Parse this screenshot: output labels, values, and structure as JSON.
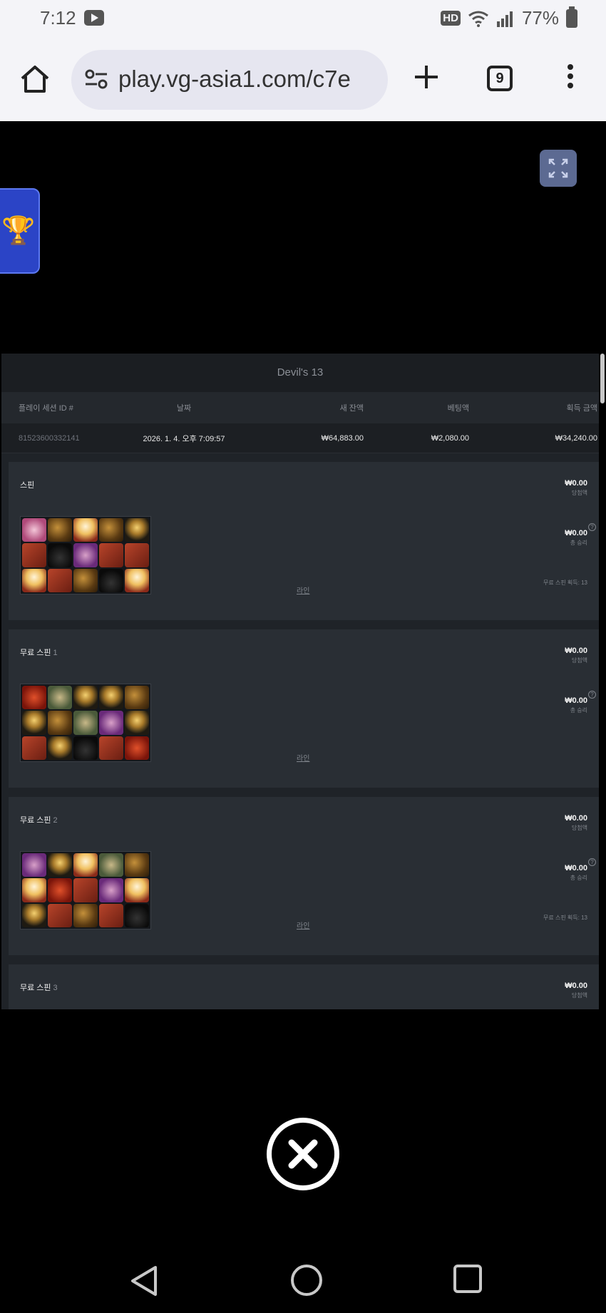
{
  "status_bar": {
    "time": "7:12",
    "hd_label": "HD",
    "battery_percent": "77%"
  },
  "browser": {
    "url": "play.vg-asia1.com/c7e",
    "tab_count": "9"
  },
  "history": {
    "game_title": "Devil's 13",
    "columns": [
      "플레이 세션 ID #",
      "날짜",
      "새 잔액",
      "베팅액",
      "획득 금액"
    ],
    "row": {
      "session_id": "81523600332141",
      "date": "2026. 1. 4. 오후 7:09:57",
      "new_balance": "₩64,883.00",
      "bet": "₩2,080.00",
      "win": "₩34,240.00"
    },
    "spins": [
      {
        "label": "스핀",
        "number": "",
        "win_amount": "₩0.00",
        "win_label": "당첨액",
        "total_amount": "₩0.00",
        "total_label": "총 승리",
        "free_spins_note": "무료 스핀 획득: 13",
        "line_link": "라인",
        "symbols": [
          "bonus",
          "bell",
          "wild",
          "bell",
          "candle",
          "book",
          "cat",
          "witch",
          "book",
          "book",
          "wild",
          "book",
          "bell",
          "cat",
          "wild"
        ]
      },
      {
        "label": "무료 스핀",
        "number": "1",
        "win_amount": "₩0.00",
        "win_label": "당첨액",
        "total_amount": "₩0.00",
        "total_label": "총 승리",
        "free_spins_note": "",
        "line_link": "라인",
        "symbols": [
          "demon",
          "skull",
          "candle",
          "candle",
          "bell",
          "candle",
          "bell",
          "skull",
          "witch",
          "candle",
          "book",
          "candle",
          "cat",
          "book",
          "demon"
        ]
      },
      {
        "label": "무료 스핀",
        "number": "2",
        "win_amount": "₩0.00",
        "win_label": "당첨액",
        "total_amount": "₩0.00",
        "total_label": "총 승리",
        "free_spins_note": "무료 스핀 획득: 13",
        "line_link": "라인",
        "symbols": [
          "witch",
          "candle",
          "wild",
          "skull",
          "bell",
          "wild",
          "demon",
          "book",
          "witch",
          "wild",
          "candle",
          "book",
          "bell",
          "book",
          "cat"
        ]
      },
      {
        "label": "무료 스핀",
        "number": "3",
        "win_amount": "₩0.00",
        "win_label": "당첨액"
      }
    ]
  },
  "colors": {
    "trophy_tab": "#2b44c6",
    "fullscreen_button": "#5c6a92",
    "panel_bg": "#1f2328",
    "card_bg": "#292e34"
  },
  "icons": {
    "trophy": "trophy-icon",
    "fullscreen": "expand-icon",
    "close": "close-icon"
  }
}
